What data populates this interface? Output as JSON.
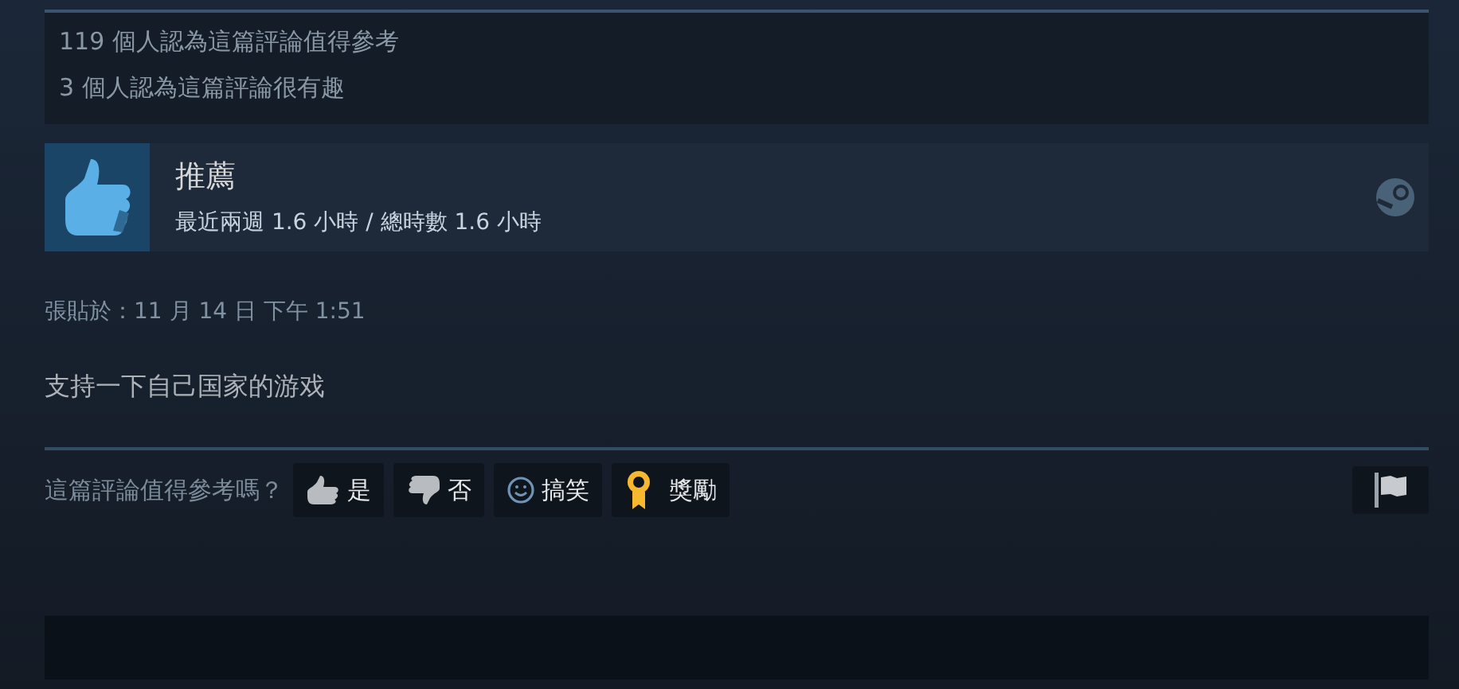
{
  "stats": [
    "119 個人認為這篇評論值得參考",
    "3 個人認為這篇評論很有趣"
  ],
  "review": {
    "verdict": "推薦",
    "recommended": true,
    "hours": "最近兩週 1.6 小時 / 總時數 1.6 小時"
  },
  "posted": "張貼於：11 月 14 日 下午 1:51",
  "body": "支持一下自己国家的游戏",
  "vote": {
    "prompt": "這篇評論值得參考嗎？",
    "buttons": [
      {
        "kind": "yes",
        "label": "是"
      },
      {
        "kind": "no",
        "label": "否"
      },
      {
        "kind": "funny",
        "label": "搞笑"
      },
      {
        "kind": "award",
        "label": "獎勵"
      }
    ]
  }
}
